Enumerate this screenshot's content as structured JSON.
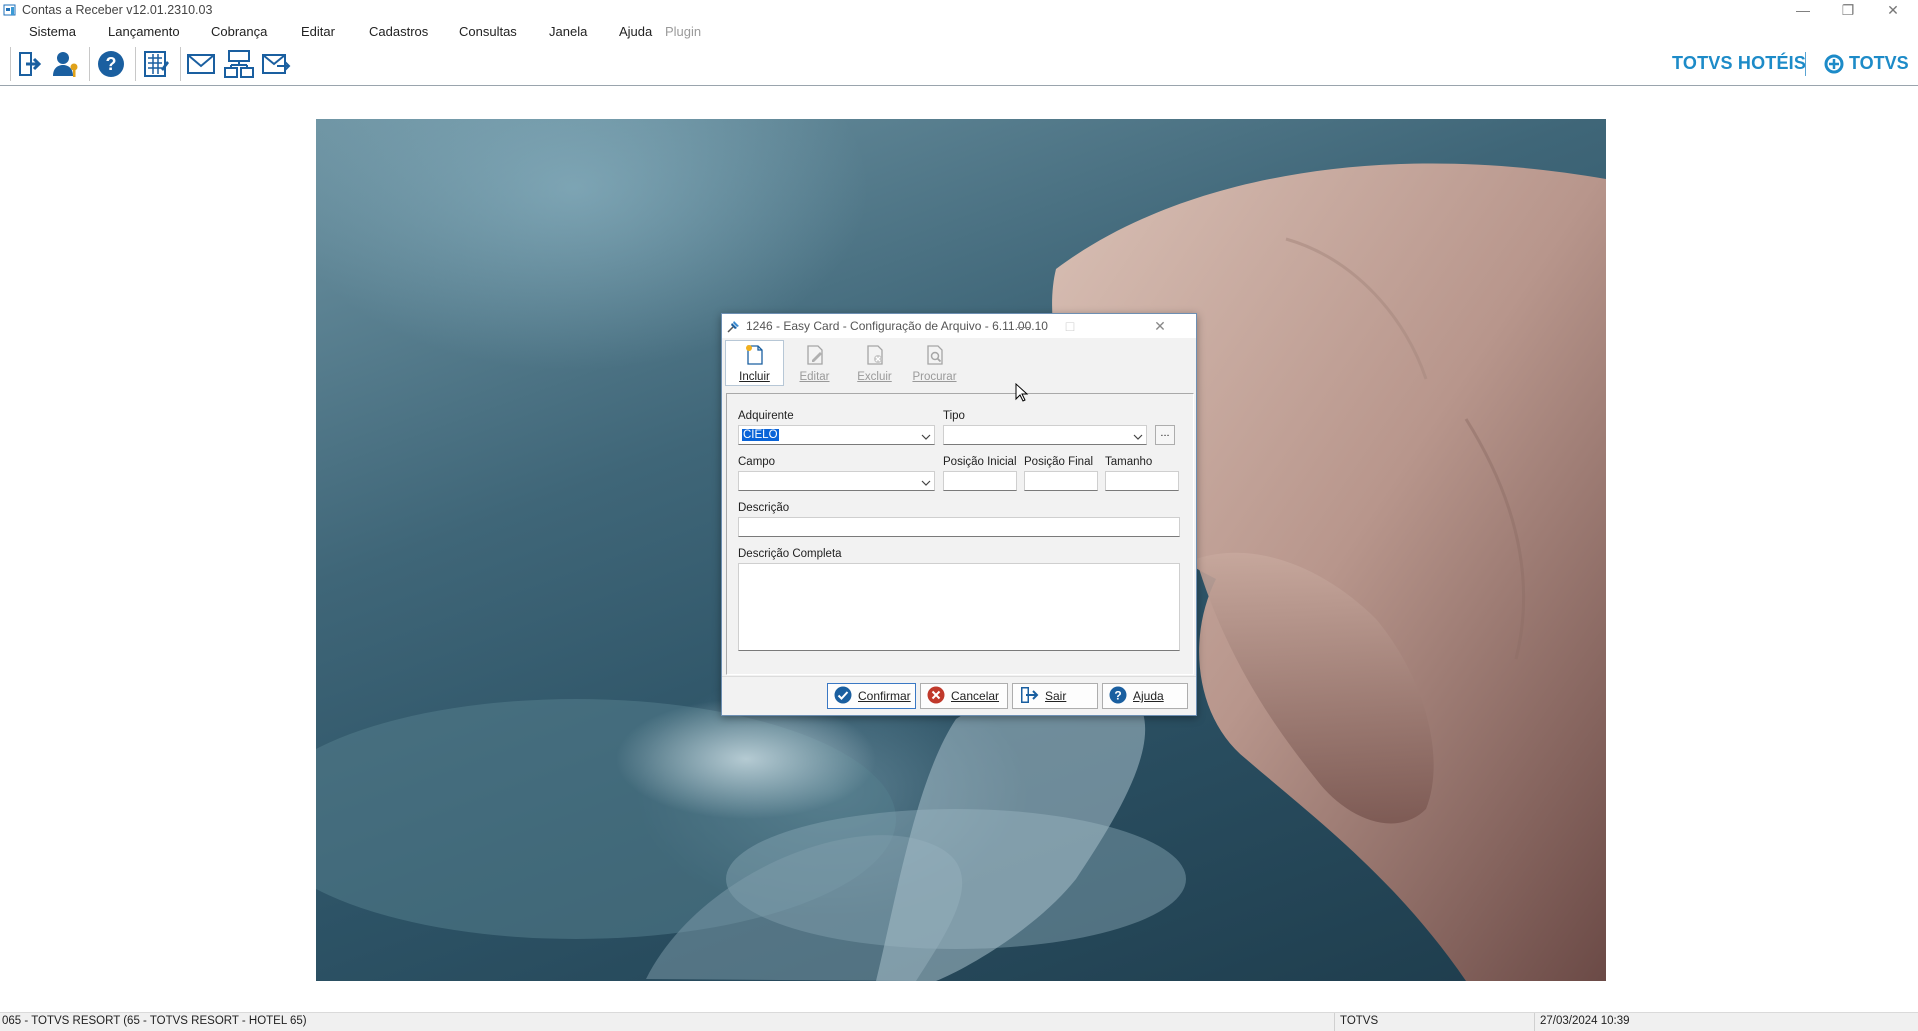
{
  "window": {
    "title": "Contas a Receber v12.01.2310.03",
    "controls": [
      "minimize",
      "restore",
      "close"
    ]
  },
  "menu": [
    {
      "label": "Sistema",
      "enabled": true
    },
    {
      "label": "Lançamento",
      "enabled": true
    },
    {
      "label": "Cobrança",
      "enabled": true
    },
    {
      "label": "Editar",
      "enabled": true
    },
    {
      "label": "Cadastros",
      "enabled": true
    },
    {
      "label": "Consultas",
      "enabled": true
    },
    {
      "label": "Janela",
      "enabled": true
    },
    {
      "label": "Ajuda",
      "enabled": true
    },
    {
      "label": "Plugin",
      "enabled": false
    }
  ],
  "toolbar": {
    "icons": [
      "exit-door-icon",
      "user-key-icon",
      "help-icon",
      "calculator-sheet-icon",
      "mail-icon",
      "network-icon",
      "mail-forward-icon"
    ]
  },
  "brand": {
    "hoteis": "TOTVS HOTÉIS",
    "totvs": "TOTVS",
    "color": "#1d8bc8"
  },
  "dialog": {
    "title": "1246 - Easy Card - Configuração de Arquivo - 6.11.00.10",
    "tools": [
      {
        "label": "Incluir",
        "enabled": true,
        "icon": "new-document-icon"
      },
      {
        "label": "Editar",
        "enabled": false,
        "icon": "edit-document-icon"
      },
      {
        "label": "Excluir",
        "enabled": false,
        "icon": "delete-document-icon"
      },
      {
        "label": "Procurar",
        "enabled": false,
        "icon": "search-document-icon"
      }
    ],
    "fields": {
      "adquirente_label": "Adquirente",
      "adquirente_value": "CIELO",
      "tipo_label": "Tipo",
      "tipo_value": "",
      "tipo_more": "...",
      "campo_label": "Campo",
      "campo_value": "",
      "posicao_inicial_label": "Posição Inicial",
      "posicao_final_label": "Posição Final",
      "tamanho_label": "Tamanho",
      "descricao_label": "Descrição",
      "descricao_completa_label": "Descrição Completa"
    },
    "buttons": {
      "confirmar": "Confirmar",
      "cancelar": "Cancelar",
      "sair": "Sair",
      "ajuda": "Ajuda"
    }
  },
  "status": {
    "company": "065 - TOTVS RESORT (65 - TOTVS RESORT - HOTEL 65)",
    "user": "TOTVS",
    "datetime": "27/03/2024 10:39"
  },
  "colors": {
    "accent": "#1d8bc8",
    "selection": "#0a64d8",
    "cancel_icon": "#c0392b"
  }
}
